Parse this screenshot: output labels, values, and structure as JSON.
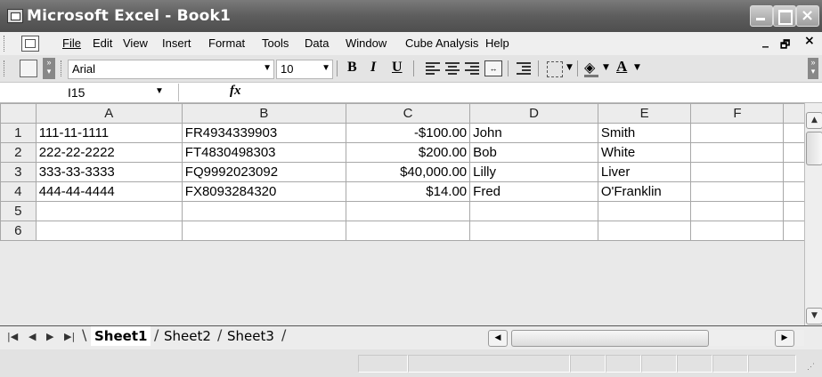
{
  "window": {
    "title": "Microsoft Excel - Book1",
    "app_icon": "excel-app-icon",
    "controls": [
      "minimize-icon",
      "maximize-icon",
      "close-icon"
    ]
  },
  "menubar": {
    "items": [
      {
        "label": "File"
      },
      {
        "label": "Edit"
      },
      {
        "label": "View"
      },
      {
        "label": "Insert"
      },
      {
        "label": "Format"
      },
      {
        "label": "Tools"
      },
      {
        "label": "Data"
      },
      {
        "label": "Window"
      },
      {
        "label": "Cube Analysis"
      },
      {
        "label": "Help"
      }
    ],
    "doc_controls": {
      "minimize": "_",
      "restore": "🗗",
      "close": "×"
    }
  },
  "toolbar": {
    "font_name": "Arial",
    "font_size": "10",
    "bold": "B",
    "italic": "I",
    "underline": "U",
    "font_color_glyph": "A",
    "fill_glyph": "◈"
  },
  "formula_bar": {
    "name_box": "I15",
    "fx": "fx",
    "content": ""
  },
  "sheet": {
    "columns": [
      "A",
      "B",
      "C",
      "D",
      "E",
      "F"
    ],
    "rows": [
      {
        "num": "1",
        "cells": [
          "111-11-1111",
          "FR4934339903",
          "-$100.00",
          "John",
          "Smith",
          ""
        ]
      },
      {
        "num": "2",
        "cells": [
          "222-22-2222",
          "FT4830498303",
          "$200.00",
          "Bob",
          "White",
          ""
        ]
      },
      {
        "num": "3",
        "cells": [
          "333-33-3333",
          "FQ9992023092",
          "$40,000.00",
          "Lilly",
          "Liver",
          ""
        ]
      },
      {
        "num": "4",
        "cells": [
          "444-44-4444",
          "FX8093284320",
          "$14.00",
          "Fred",
          "O'Franklin",
          ""
        ]
      },
      {
        "num": "5",
        "cells": [
          "",
          "",
          "",
          "",
          "",
          ""
        ]
      },
      {
        "num": "6",
        "cells": [
          "",
          "",
          "",
          "",
          "",
          ""
        ]
      }
    ]
  },
  "sheet_tabs": {
    "tabs": [
      {
        "label": "Sheet1",
        "active": true
      },
      {
        "label": "Sheet2",
        "active": false
      },
      {
        "label": "Sheet3",
        "active": false
      }
    ]
  }
}
